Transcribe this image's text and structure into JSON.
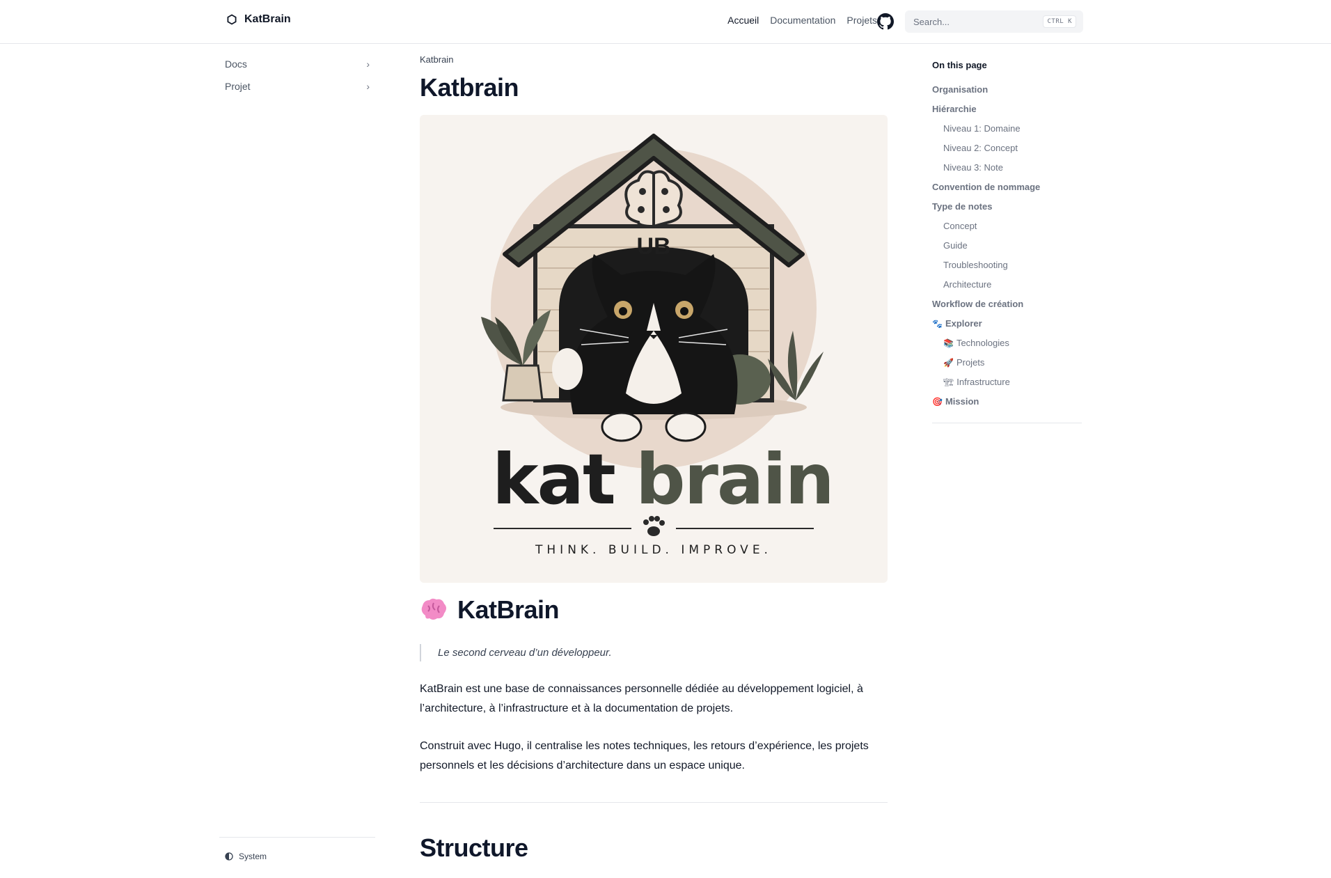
{
  "header": {
    "brand": "KatBrain",
    "nav": [
      {
        "label": "Accueil",
        "active": true
      },
      {
        "label": "Documentation",
        "active": false
      },
      {
        "label": "Projets",
        "active": false
      }
    ],
    "search_placeholder": "Search...",
    "search_shortcut": "CTRL K"
  },
  "sidebar": {
    "items": [
      {
        "label": "Docs"
      },
      {
        "label": "Projet"
      }
    ],
    "theme_label": "System"
  },
  "main": {
    "breadcrumb": "Katbrain",
    "title": "Katbrain",
    "logo": {
      "badge": "UB",
      "word_dark": "kat",
      "word_green": "brain",
      "tagline": "THINK. BUILD. IMPROVE."
    },
    "brand_heading": "KatBrain",
    "quote": "Le second cerveau d’un développeur.",
    "paragraphs": [
      "KatBrain est une base de connaissances personnelle dédiée au développement logiciel, à l’architecture, à l’infrastructure et à la documentation de projets.",
      "Construit avec Hugo, il centralise les notes techniques, les retours d’expérience, les projets personnels et les décisions d’architecture dans un espace unique."
    ],
    "section_heading": "Structure"
  },
  "toc": {
    "title": "On this page",
    "items": [
      {
        "label": "Organisation",
        "level": 1,
        "emoji": ""
      },
      {
        "label": "Hiérarchie",
        "level": 1,
        "emoji": ""
      },
      {
        "label": "Niveau 1: Domaine",
        "level": 2,
        "emoji": ""
      },
      {
        "label": "Niveau 2: Concept",
        "level": 2,
        "emoji": ""
      },
      {
        "label": "Niveau 3: Note",
        "level": 2,
        "emoji": ""
      },
      {
        "label": "Convention de nommage",
        "level": 1,
        "emoji": ""
      },
      {
        "label": "Type de notes",
        "level": 1,
        "emoji": ""
      },
      {
        "label": "Concept",
        "level": 2,
        "emoji": ""
      },
      {
        "label": "Guide",
        "level": 2,
        "emoji": ""
      },
      {
        "label": "Troubleshooting",
        "level": 2,
        "emoji": ""
      },
      {
        "label": "Architecture",
        "level": 2,
        "emoji": ""
      },
      {
        "label": "Workflow de création",
        "level": 1,
        "emoji": ""
      },
      {
        "label": "Explorer",
        "level": 1,
        "emoji": "🐾"
      },
      {
        "label": "Technologies",
        "level": 2,
        "emoji": "📚"
      },
      {
        "label": "Projets",
        "level": 2,
        "emoji": "🚀"
      },
      {
        "label": "Infrastructure",
        "level": 2,
        "emoji": "🏗"
      },
      {
        "label": "Mission",
        "level": 1,
        "emoji": "🎯"
      }
    ]
  },
  "colors": {
    "text": "#111827",
    "muted": "#6b7280",
    "logo_bg": "#f7f3ef",
    "logo_green": "#4f5447",
    "logo_dark": "#1e1e1e"
  }
}
